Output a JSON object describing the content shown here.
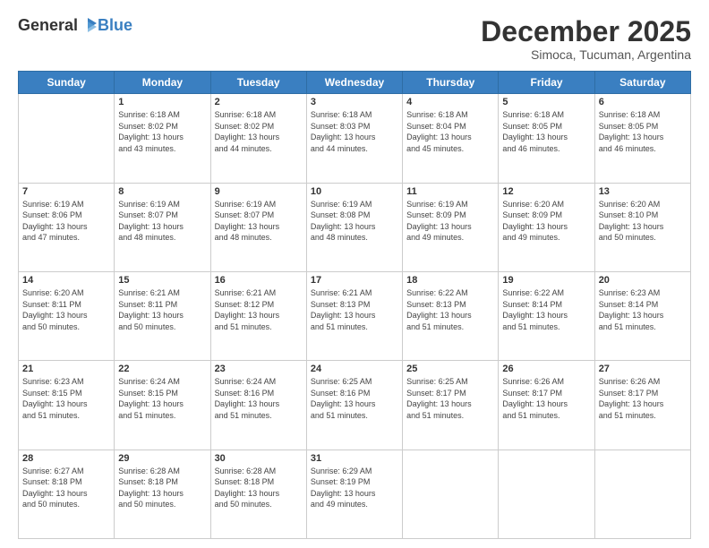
{
  "header": {
    "logo": {
      "general": "General",
      "blue": "Blue"
    },
    "title": "December 2025",
    "subtitle": "Simoca, Tucuman, Argentina"
  },
  "calendar": {
    "days_of_week": [
      "Sunday",
      "Monday",
      "Tuesday",
      "Wednesday",
      "Thursday",
      "Friday",
      "Saturday"
    ],
    "weeks": [
      [
        {
          "day": "",
          "info": ""
        },
        {
          "day": "1",
          "info": "Sunrise: 6:18 AM\nSunset: 8:02 PM\nDaylight: 13 hours\nand 43 minutes."
        },
        {
          "day": "2",
          "info": "Sunrise: 6:18 AM\nSunset: 8:02 PM\nDaylight: 13 hours\nand 44 minutes."
        },
        {
          "day": "3",
          "info": "Sunrise: 6:18 AM\nSunset: 8:03 PM\nDaylight: 13 hours\nand 44 minutes."
        },
        {
          "day": "4",
          "info": "Sunrise: 6:18 AM\nSunset: 8:04 PM\nDaylight: 13 hours\nand 45 minutes."
        },
        {
          "day": "5",
          "info": "Sunrise: 6:18 AM\nSunset: 8:05 PM\nDaylight: 13 hours\nand 46 minutes."
        },
        {
          "day": "6",
          "info": "Sunrise: 6:18 AM\nSunset: 8:05 PM\nDaylight: 13 hours\nand 46 minutes."
        }
      ],
      [
        {
          "day": "7",
          "info": "Sunrise: 6:19 AM\nSunset: 8:06 PM\nDaylight: 13 hours\nand 47 minutes."
        },
        {
          "day": "8",
          "info": "Sunrise: 6:19 AM\nSunset: 8:07 PM\nDaylight: 13 hours\nand 48 minutes."
        },
        {
          "day": "9",
          "info": "Sunrise: 6:19 AM\nSunset: 8:07 PM\nDaylight: 13 hours\nand 48 minutes."
        },
        {
          "day": "10",
          "info": "Sunrise: 6:19 AM\nSunset: 8:08 PM\nDaylight: 13 hours\nand 48 minutes."
        },
        {
          "day": "11",
          "info": "Sunrise: 6:19 AM\nSunset: 8:09 PM\nDaylight: 13 hours\nand 49 minutes."
        },
        {
          "day": "12",
          "info": "Sunrise: 6:20 AM\nSunset: 8:09 PM\nDaylight: 13 hours\nand 49 minutes."
        },
        {
          "day": "13",
          "info": "Sunrise: 6:20 AM\nSunset: 8:10 PM\nDaylight: 13 hours\nand 50 minutes."
        }
      ],
      [
        {
          "day": "14",
          "info": "Sunrise: 6:20 AM\nSunset: 8:11 PM\nDaylight: 13 hours\nand 50 minutes."
        },
        {
          "day": "15",
          "info": "Sunrise: 6:21 AM\nSunset: 8:11 PM\nDaylight: 13 hours\nand 50 minutes."
        },
        {
          "day": "16",
          "info": "Sunrise: 6:21 AM\nSunset: 8:12 PM\nDaylight: 13 hours\nand 51 minutes."
        },
        {
          "day": "17",
          "info": "Sunrise: 6:21 AM\nSunset: 8:13 PM\nDaylight: 13 hours\nand 51 minutes."
        },
        {
          "day": "18",
          "info": "Sunrise: 6:22 AM\nSunset: 8:13 PM\nDaylight: 13 hours\nand 51 minutes."
        },
        {
          "day": "19",
          "info": "Sunrise: 6:22 AM\nSunset: 8:14 PM\nDaylight: 13 hours\nand 51 minutes."
        },
        {
          "day": "20",
          "info": "Sunrise: 6:23 AM\nSunset: 8:14 PM\nDaylight: 13 hours\nand 51 minutes."
        }
      ],
      [
        {
          "day": "21",
          "info": "Sunrise: 6:23 AM\nSunset: 8:15 PM\nDaylight: 13 hours\nand 51 minutes."
        },
        {
          "day": "22",
          "info": "Sunrise: 6:24 AM\nSunset: 8:15 PM\nDaylight: 13 hours\nand 51 minutes."
        },
        {
          "day": "23",
          "info": "Sunrise: 6:24 AM\nSunset: 8:16 PM\nDaylight: 13 hours\nand 51 minutes."
        },
        {
          "day": "24",
          "info": "Sunrise: 6:25 AM\nSunset: 8:16 PM\nDaylight: 13 hours\nand 51 minutes."
        },
        {
          "day": "25",
          "info": "Sunrise: 6:25 AM\nSunset: 8:17 PM\nDaylight: 13 hours\nand 51 minutes."
        },
        {
          "day": "26",
          "info": "Sunrise: 6:26 AM\nSunset: 8:17 PM\nDaylight: 13 hours\nand 51 minutes."
        },
        {
          "day": "27",
          "info": "Sunrise: 6:26 AM\nSunset: 8:17 PM\nDaylight: 13 hours\nand 51 minutes."
        }
      ],
      [
        {
          "day": "28",
          "info": "Sunrise: 6:27 AM\nSunset: 8:18 PM\nDaylight: 13 hours\nand 50 minutes."
        },
        {
          "day": "29",
          "info": "Sunrise: 6:28 AM\nSunset: 8:18 PM\nDaylight: 13 hours\nand 50 minutes."
        },
        {
          "day": "30",
          "info": "Sunrise: 6:28 AM\nSunset: 8:18 PM\nDaylight: 13 hours\nand 50 minutes."
        },
        {
          "day": "31",
          "info": "Sunrise: 6:29 AM\nSunset: 8:19 PM\nDaylight: 13 hours\nand 49 minutes."
        },
        {
          "day": "",
          "info": ""
        },
        {
          "day": "",
          "info": ""
        },
        {
          "day": "",
          "info": ""
        }
      ]
    ]
  }
}
